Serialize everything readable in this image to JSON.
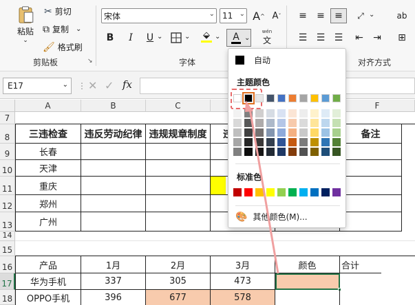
{
  "ribbon": {
    "clipboard": {
      "paste": "粘贴",
      "cut": "剪切",
      "copy": "复制",
      "format_painter": "格式刷",
      "group_label": "剪贴板"
    },
    "font": {
      "font_name": "宋体",
      "font_size": "11",
      "bold": "B",
      "italic": "I",
      "underline": "U",
      "font_color_letter": "A",
      "wen": "wén",
      "wen_char": "文",
      "group_label": "字体"
    },
    "alignment": {
      "group_label": "对齐方式"
    }
  },
  "formula_bar": {
    "cell_ref": "E17",
    "fx": "fx"
  },
  "columns": [
    "A",
    "B",
    "C",
    "D",
    "E",
    "F"
  ],
  "rows": [
    "7",
    "8",
    "9",
    "10",
    "11",
    "12",
    "13",
    "14",
    "15",
    "16",
    "17",
    "18"
  ],
  "table1": {
    "headers": [
      "三违检查",
      "违反劳动纪律",
      "违规规章制度",
      "违",
      "",
      "备注"
    ],
    "cities": [
      "长春",
      "天津",
      "重庆",
      "郑州",
      "广州"
    ]
  },
  "table2": {
    "headers": [
      "产品",
      "1月",
      "2月",
      "3月",
      "颜色",
      "合计"
    ],
    "rows": [
      [
        "华为手机",
        "337",
        "305",
        "473",
        "",
        ""
      ],
      [
        "OPPO手机",
        "396",
        "677",
        "578",
        "",
        ""
      ]
    ]
  },
  "color_dropdown": {
    "auto_label": "自动",
    "theme_label": "主题颜色",
    "standard_label": "标准色",
    "more_colors_label": "其他颜色(M)...",
    "theme_top": [
      "#ffffff",
      "#000000",
      "#e7e6e6",
      "#44546a",
      "#4472c4",
      "#ed7d31",
      "#a5a5a5",
      "#ffc000",
      "#5b9bd5",
      "#70ad47"
    ],
    "theme_columns": [
      [
        "#f2f2f2",
        "#d9d9d9",
        "#bfbfbf",
        "#a6a6a6",
        "#808080"
      ],
      [
        "#808080",
        "#595959",
        "#404040",
        "#262626",
        "#0d0d0d"
      ],
      [
        "#d0cece",
        "#aeabab",
        "#757171",
        "#3a3838",
        "#171616"
      ],
      [
        "#d6dce4",
        "#adb9ca",
        "#8496b0",
        "#333f4f",
        "#222a35"
      ],
      [
        "#d9e2f3",
        "#b4c6e7",
        "#8eaadb",
        "#2f5496",
        "#1f3864"
      ],
      [
        "#fbe5d5",
        "#f7caac",
        "#f4b183",
        "#c55a11",
        "#833c0b"
      ],
      [
        "#ededed",
        "#dbdbdb",
        "#c9c9c9",
        "#7b7b7b",
        "#525252"
      ],
      [
        "#fff2cc",
        "#ffe599",
        "#ffd966",
        "#bf9000",
        "#7f6000"
      ],
      [
        "#deebf6",
        "#bdd7ee",
        "#9cc3e5",
        "#2e75b5",
        "#1e4e79"
      ],
      [
        "#e2efd9",
        "#c5e0b3",
        "#a8d08d",
        "#538135",
        "#375623"
      ]
    ],
    "standard": [
      "#c00000",
      "#ff0000",
      "#ffc000",
      "#ffff00",
      "#92d050",
      "#00b050",
      "#00b0f0",
      "#0070c0",
      "#002060",
      "#7030a0"
    ]
  }
}
